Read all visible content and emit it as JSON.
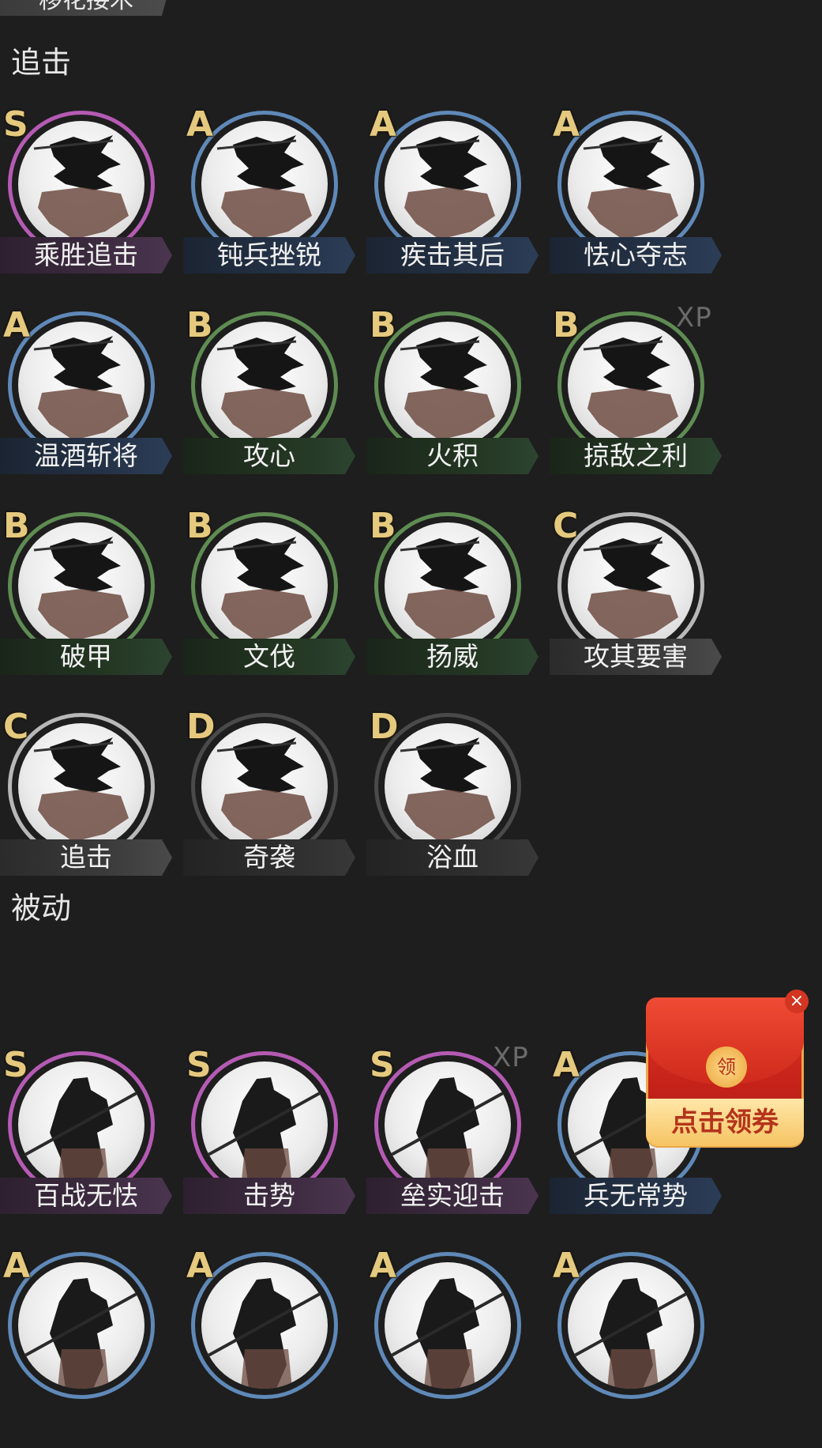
{
  "top_tab": {
    "label": "移花接木"
  },
  "sections": [
    {
      "title": "追击",
      "items": [
        {
          "grade": "S",
          "name": "乘胜追击"
        },
        {
          "grade": "A",
          "name": "钝兵挫锐"
        },
        {
          "grade": "A",
          "name": "疾击其后"
        },
        {
          "grade": "A",
          "name": "怯心夺志"
        },
        {
          "grade": "A",
          "name": "温酒斩将"
        },
        {
          "grade": "B",
          "name": "攻心"
        },
        {
          "grade": "B",
          "name": "火积"
        },
        {
          "grade": "B",
          "name": "掠敌之利",
          "xp": "XP"
        },
        {
          "grade": "B",
          "name": "破甲"
        },
        {
          "grade": "B",
          "name": "文伐"
        },
        {
          "grade": "B",
          "name": "扬威"
        },
        {
          "grade": "C",
          "name": "攻其要害"
        },
        {
          "grade": "C",
          "name": "追击"
        },
        {
          "grade": "D",
          "name": "奇袭"
        },
        {
          "grade": "D",
          "name": "浴血"
        }
      ]
    },
    {
      "title": "被动",
      "items": [
        {
          "grade": "S",
          "name": "百战无怯"
        },
        {
          "grade": "S",
          "name": "击势"
        },
        {
          "grade": "S",
          "name": "垒实迎击",
          "xp": "XP"
        },
        {
          "grade": "A",
          "name": "兵无常势"
        },
        {
          "grade": "A",
          "name": ""
        },
        {
          "grade": "A",
          "name": ""
        },
        {
          "grade": "A",
          "name": ""
        },
        {
          "grade": "A",
          "name": ""
        }
      ]
    }
  ],
  "coupon": {
    "seal": "领",
    "label": "点击领券",
    "close": "×"
  }
}
